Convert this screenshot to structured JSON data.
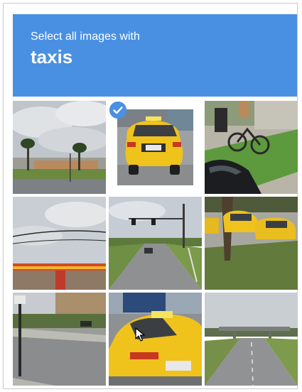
{
  "header": {
    "instruction": "Select all images with",
    "object": "taxis"
  },
  "colors": {
    "header_bg": "#4a90e2",
    "header_text": "#ffffff",
    "taxi_yellow": "#f0c21c",
    "sky": "#cfd6dd",
    "road": "#8b8d8f",
    "grass": "#6f8a45"
  },
  "grid": {
    "rows": 3,
    "cols": 3,
    "tiles": [
      {
        "row": 0,
        "col": 0,
        "selected": false
      },
      {
        "row": 0,
        "col": 1,
        "selected": true
      },
      {
        "row": 0,
        "col": 2,
        "selected": false
      },
      {
        "row": 1,
        "col": 0,
        "selected": false
      },
      {
        "row": 1,
        "col": 1,
        "selected": false
      },
      {
        "row": 1,
        "col": 2,
        "selected": false
      },
      {
        "row": 2,
        "col": 0,
        "selected": false
      },
      {
        "row": 2,
        "col": 1,
        "selected": false
      },
      {
        "row": 2,
        "col": 2,
        "selected": false
      }
    ]
  },
  "icons": {
    "selected_badge": "checkmark-circle-icon",
    "pointer": "mouse-cursor-icon"
  }
}
